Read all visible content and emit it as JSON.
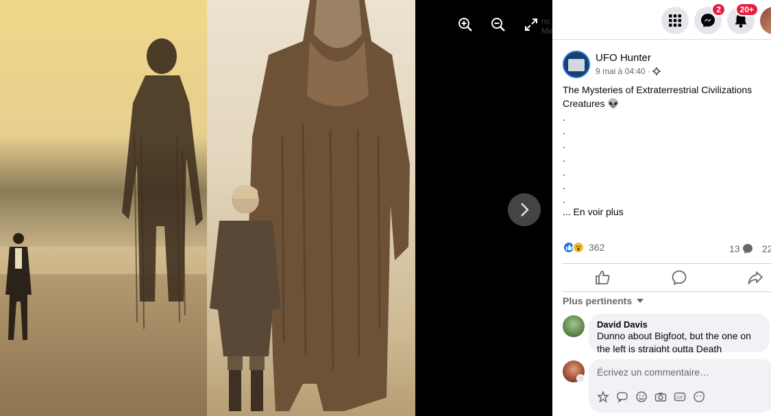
{
  "viewer": {
    "zoom_in_icon": "zoom-in-icon",
    "zoom_out_icon": "zoom-out-icon",
    "fullscreen_icon": "fullscreen-icon",
    "next_icon": "chevron-right-icon",
    "ghost_text": "ns de Messenger"
  },
  "topbar": {
    "menu_icon": "grid-menu-icon",
    "messenger_icon": "messenger-icon",
    "messenger_badge": "2",
    "notifications_icon": "bell-icon",
    "notifications_badge": "20+"
  },
  "post": {
    "page_name": "UFO Hunter",
    "timestamp": "9 mai à 04:40",
    "audience_icon": "gear-icon",
    "text_line": "The Mysteries of Extraterrestrial Civilizations Creatures",
    "text_emoji": "👽",
    "dots": [
      ".",
      ".",
      ".",
      ".",
      ".",
      ".",
      "."
    ],
    "see_more": "... En voir plus",
    "reaction_count": "362",
    "comment_count": "13",
    "share_count": "22"
  },
  "actions": {
    "like_icon": "thumbs-up-icon",
    "comment_icon": "comment-icon",
    "share_icon": "share-icon"
  },
  "comments": {
    "sort_label": "Plus pertinents",
    "items": [
      {
        "author": "David Davis",
        "text": "Dunno about Bigfoot, but the one on the left is straight outta Death"
      }
    ]
  },
  "composer": {
    "placeholder": "Écrivez un commentaire…",
    "tools": [
      "sticker-icon",
      "chat-icon",
      "emoji-icon",
      "camera-icon",
      "gif-icon",
      "face-sticker-icon"
    ]
  },
  "colors": {
    "brand_blue": "#1877f2",
    "badge_red": "#e41e3f",
    "bubble_gray": "#f0f2f5"
  }
}
